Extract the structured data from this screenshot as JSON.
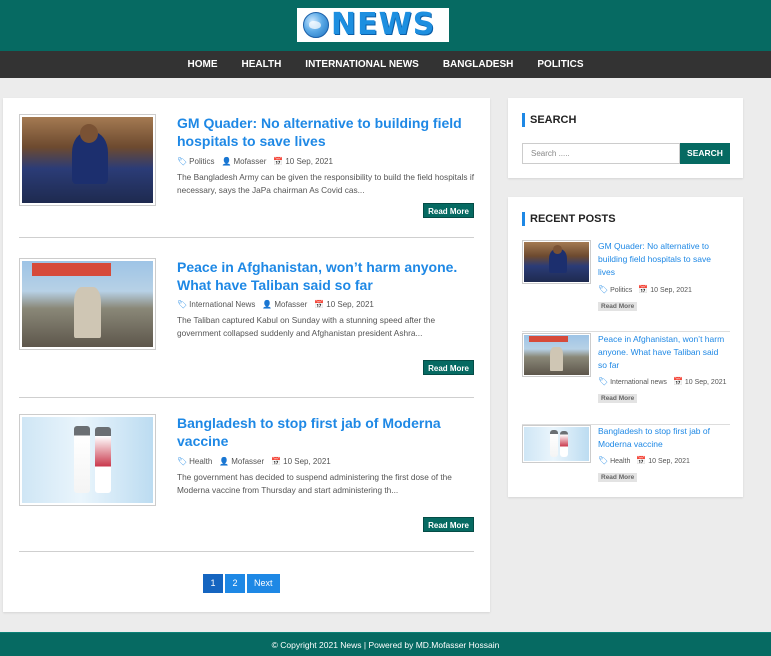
{
  "brand": {
    "logo_text": "NEWS"
  },
  "nav": [
    "HOME",
    "HEALTH",
    "INTERNATIONAL NEWS",
    "BANGLADESH",
    "POLITICS"
  ],
  "posts": [
    {
      "title": "GM Quader: No alternative to building field hospitals to save lives",
      "category": "Politics",
      "author": "Mofasser",
      "date": "10 Sep, 2021",
      "excerpt": "The Bangladesh Army can be given the responsibility to build the field hospitals if necessary, says the JaPa chairman As Covid cas...",
      "read_more": "Read More",
      "image": "press-conference"
    },
    {
      "title": "Peace in Afghanistan, won’t harm anyone. What have Taliban said so far",
      "category": "International News",
      "author": "Mofasser",
      "date": "10 Sep, 2021",
      "excerpt": "The Taliban captured Kabul on Sunday with a stunning speed after the government collapsed suddenly and Afghanistan president Ashra...",
      "read_more": "Read More",
      "image": "taliban-kabul"
    },
    {
      "title": "Bangladesh to stop first jab of Moderna vaccine",
      "category": "Health",
      "author": "Mofasser",
      "date": "10 Sep, 2021",
      "excerpt": "The government has decided to suspend administering the first dose of the Moderna vaccine from Thursday and start administering th...",
      "read_more": "Read More",
      "image": "vaccine-vials"
    }
  ],
  "pagination": [
    "1",
    "2",
    "Next"
  ],
  "search": {
    "title": "SEARCH",
    "placeholder": "Search .....",
    "button": "SEARCH"
  },
  "recent": {
    "title": "RECENT POSTS",
    "items": [
      {
        "title": "GM Quader: No alternative to building field hospitals to save lives",
        "category": "Politics",
        "date": "10 Sep, 2021",
        "read_more": "Read More"
      },
      {
        "title": "Peace in Afghanistan, won’t harm anyone. What have Taliban said so far",
        "category": "International news",
        "date": "10 Sep, 2021",
        "read_more": "Read More"
      },
      {
        "title": "Bangladesh to stop first jab of Moderna vaccine",
        "category": "Health",
        "date": "10 Sep, 2021",
        "read_more": "Read More"
      }
    ]
  },
  "footer": {
    "text": "© Copyright 2021 News | Powered by MD.Mofasser Hossain"
  },
  "colors": {
    "primary": "#066a62",
    "link": "#1e88e5",
    "nav_bg": "#333333"
  }
}
